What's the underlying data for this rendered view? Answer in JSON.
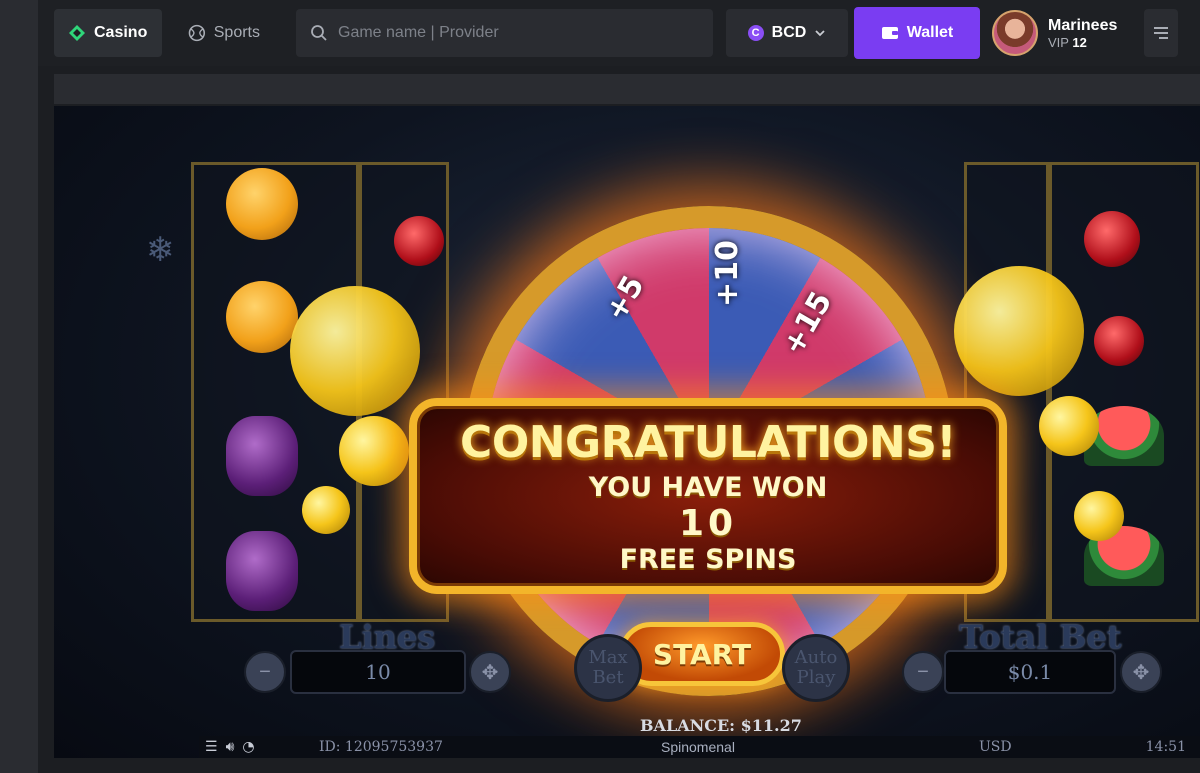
{
  "nav": {
    "casino_label": "Casino",
    "sports_label": "Sports"
  },
  "search": {
    "placeholder": "Game name | Provider"
  },
  "currency": {
    "code": "BCD",
    "coin_symbol": "C"
  },
  "wallet": {
    "label": "Wallet"
  },
  "user": {
    "name": "Marinees",
    "vip_label": "VIP",
    "vip_level": "12"
  },
  "game": {
    "wheel_labels": [
      "+5",
      "+10",
      "+15"
    ],
    "congrats_title": "CONGRATULATIONS!",
    "won_text": "YOU HAVE WON",
    "spins_count": "10",
    "free_spins_text": "FREE SPINS",
    "start_label": "START",
    "lines_title": "Lines",
    "lines_value": "10",
    "total_bet_title": "Total Bet",
    "total_bet_value": "$0.1",
    "max_bet_label": "Max Bet",
    "auto_play_label": "Auto Play",
    "balance_text": "BALANCE: $11.27",
    "game_id_text": "ID: 12095753937",
    "provider_name": "Spinomenal",
    "currency_text": "USD",
    "clock_text": "14:51"
  },
  "colors": {
    "accent": "#7a3df2",
    "casino_icon": "#2fd67a",
    "topbar_bg": "#1e2024"
  }
}
